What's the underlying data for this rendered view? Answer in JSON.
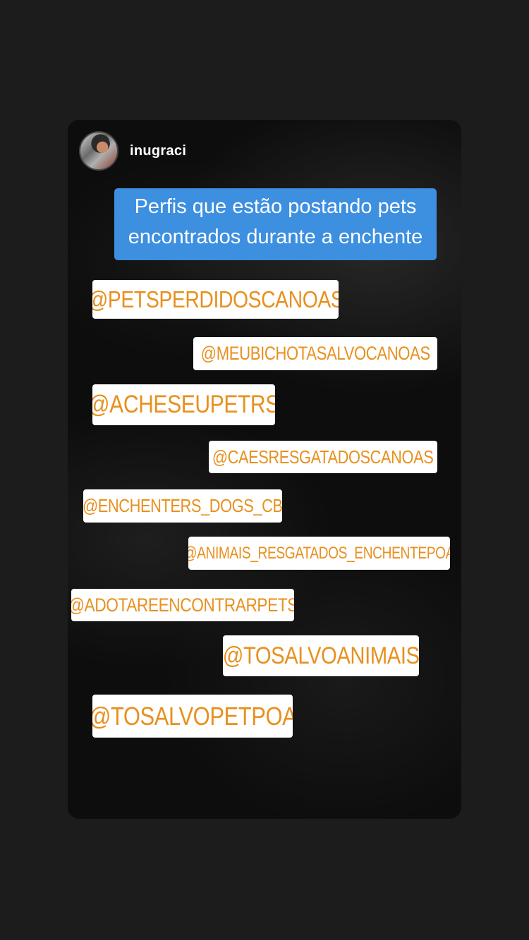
{
  "story": {
    "username": "inugraci",
    "headline_line1": "Perfis que estão postando pets",
    "headline_line2": "encontrados durante a enchente",
    "headline_color": "#3d8fe0",
    "mention_text_color": "#e8901e",
    "mentions": [
      "@PETSPERDIDOSCANOAS",
      "@MEUBICHOTASALVOCANOAS",
      "@ACHESEUPETRS",
      "@CAESRESGATADOSCANOAS",
      "@ENCHENTERS_DOGS_CB",
      "@ANIMAIS_RESGATADOS_ENCHENTEPOA",
      "@ADOTAREENCONTRARPETS",
      "@TOSALVOANIMAIS",
      "@TOSALVOPETPOA"
    ]
  }
}
